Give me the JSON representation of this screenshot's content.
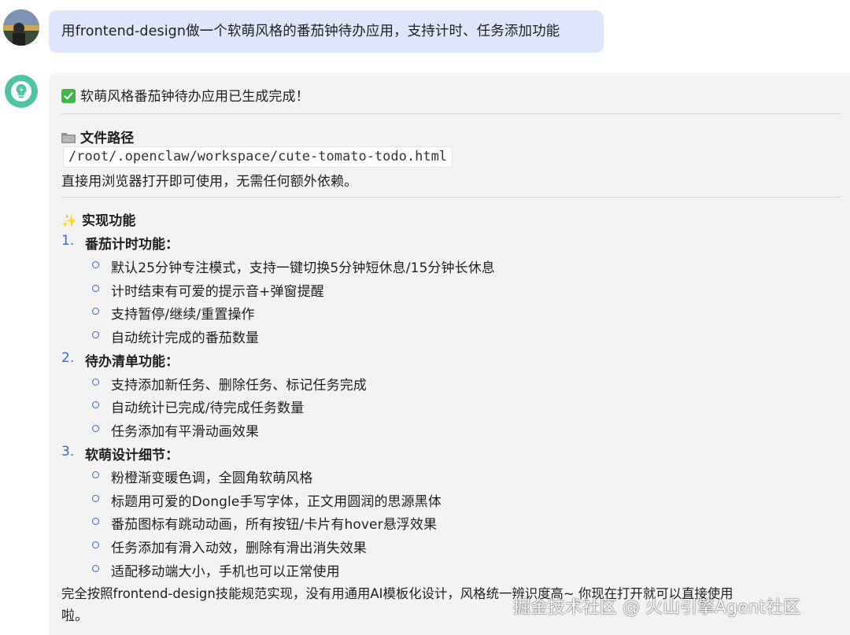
{
  "user_message": {
    "text": "用frontend-design做一个软萌风格的番茄钟待办应用，支持计时、任务添加功能",
    "avatar": "user-avatar"
  },
  "bot_message": {
    "avatar_icon": "lightbulb-icon",
    "status": "软萌风格番茄钟待办应用已生成完成！",
    "file_section": {
      "title": "文件路径",
      "path": "/root/.openclaw/workspace/cute-tomato-todo.html",
      "note": "直接用浏览器打开即可使用，无需任何额外依赖。"
    },
    "features_title": "实现功能",
    "features": [
      {
        "num": "1.",
        "title": "番茄计时功能：",
        "items": [
          "默认25分钟专注模式，支持一键切换5分钟短休息/15分钟长休息",
          "计时结束有可爱的提示音+弹窗提醒",
          "支持暂停/继续/重置操作",
          "自动统计完成的番茄数量"
        ]
      },
      {
        "num": "2.",
        "title": "待办清单功能：",
        "items": [
          "支持添加新任务、删除任务、标记任务完成",
          "自动统计已完成/待完成任务数量",
          "任务添加有平滑动画效果"
        ]
      },
      {
        "num": "3.",
        "title": "软萌设计细节：",
        "items": [
          "粉橙渐变暖色调，全圆角软萌风格",
          "标题用可爱的Dongle手写字体，正文用圆润的思源黑体",
          "番茄图标有跳动动画，所有按钮/卡片有hover悬浮效果",
          "任务添加有滑入动效，删除有滑出消失效果",
          "适配移动端大小，手机也可以正常使用"
        ]
      }
    ],
    "closing_line1": "完全按照frontend-design技能规范实现，没有用通用AI模板化设计，风格统一辨识度高~ 你现在打开就可以直接使用",
    "closing_line2": "啦。"
  },
  "watermark": "掘金技术社区 @ 火山引擎Agent社区",
  "colors": {
    "user_bubble": "#dde6fb",
    "bot_bubble": "#f3f3f5",
    "bot_avatar": "#4fc4a3",
    "list_accent": "#3a66d6",
    "check": "#43b649"
  }
}
